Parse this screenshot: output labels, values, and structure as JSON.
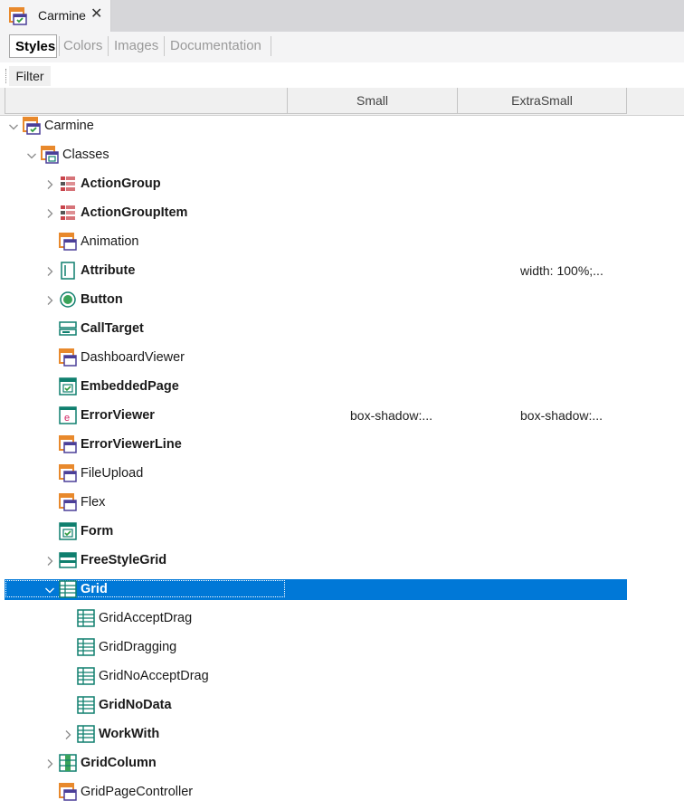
{
  "document_tab": {
    "title": "Carmine",
    "close_glyph": "✕",
    "icon": "style-object-icon"
  },
  "subtabs": [
    "Styles",
    "Colors",
    "Images",
    "Documentation"
  ],
  "filter": {
    "label": "Filter",
    "value": ""
  },
  "columns": {
    "first": "",
    "small": "Small",
    "extra_small": "ExtraSmall"
  },
  "tree": [
    {
      "label": "Carmine",
      "bold": false,
      "expander": "expanded",
      "icon": "style-object-icon"
    },
    {
      "label": "Classes",
      "bold": false,
      "expander": "expanded",
      "icon": "classes-folder-icon"
    },
    {
      "label": "ActionGroup",
      "bold": true,
      "expander": "collapsed",
      "icon": "action-group-icon"
    },
    {
      "label": "ActionGroupItem",
      "bold": true,
      "expander": "collapsed",
      "icon": "action-group-icon"
    },
    {
      "label": "Animation",
      "bold": false,
      "expander": "none",
      "icon": "class-icon"
    },
    {
      "label": "Attribute",
      "bold": true,
      "expander": "collapsed",
      "icon": "attribute-icon",
      "extra_small": "width: 100%;..."
    },
    {
      "label": "Button",
      "bold": true,
      "expander": "collapsed",
      "icon": "button-icon"
    },
    {
      "label": "CallTarget",
      "bold": true,
      "expander": "none",
      "icon": "call-target-icon"
    },
    {
      "label": "DashboardViewer",
      "bold": false,
      "expander": "none",
      "icon": "class-icon"
    },
    {
      "label": "EmbeddedPage",
      "bold": true,
      "expander": "none",
      "icon": "embedded-page-icon"
    },
    {
      "label": "ErrorViewer",
      "bold": true,
      "expander": "none",
      "icon": "error-viewer-icon",
      "small": "box-shadow:...",
      "extra_small": "box-shadow:..."
    },
    {
      "label": "ErrorViewerLine",
      "bold": true,
      "expander": "none",
      "icon": "class-icon"
    },
    {
      "label": "FileUpload",
      "bold": false,
      "expander": "none",
      "icon": "class-icon"
    },
    {
      "label": "Flex",
      "bold": false,
      "expander": "none",
      "icon": "class-icon"
    },
    {
      "label": "Form",
      "bold": true,
      "expander": "none",
      "icon": "embedded-page-icon"
    },
    {
      "label": "FreeStyleGrid",
      "bold": true,
      "expander": "collapsed",
      "icon": "freestyle-grid-icon"
    },
    {
      "label": "Grid",
      "bold": true,
      "expander": "expanded",
      "icon": "grid-icon",
      "selected": true
    },
    {
      "label": "GridAcceptDrag",
      "bold": false,
      "expander": "none",
      "icon": "grid-icon"
    },
    {
      "label": "GridDragging",
      "bold": false,
      "expander": "none",
      "icon": "grid-icon"
    },
    {
      "label": "GridNoAcceptDrag",
      "bold": false,
      "expander": "none",
      "icon": "grid-icon"
    },
    {
      "label": "GridNoData",
      "bold": true,
      "expander": "none",
      "icon": "grid-icon"
    },
    {
      "label": "WorkWith",
      "bold": true,
      "expander": "collapsed",
      "icon": "grid-icon"
    },
    {
      "label": "GridColumn",
      "bold": true,
      "expander": "collapsed",
      "icon": "grid-column-icon"
    },
    {
      "label": "GridPageController",
      "bold": false,
      "expander": "none",
      "icon": "class-icon"
    }
  ],
  "colors": {
    "selection": "#0078d7",
    "orange": "#e8892c",
    "purple": "#4b3f99",
    "teal": "#0f7f6e",
    "red": "#c8444b"
  }
}
